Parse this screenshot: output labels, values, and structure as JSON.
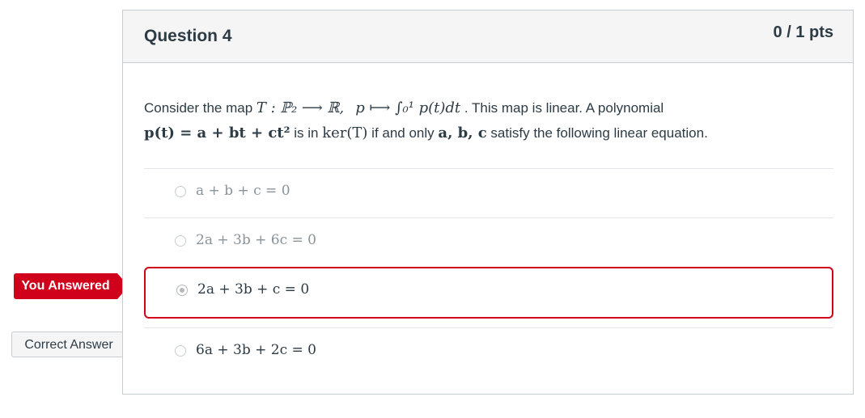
{
  "question": {
    "title": "Question 4",
    "points": "0 / 1 pts",
    "text_1": "Consider the map",
    "map_def": "T : ℙ₂ ⟶ ℝ,",
    "map_rule": "p ⟼ ∫₀¹ p(t)dt",
    "text_2": ". This map is linear. A polynomial",
    "poly": "p(t) = a + bt + ct²",
    "text_3": "is in",
    "kernel": "ker(T)",
    "text_4": "if and only",
    "vars": "a, b, c",
    "text_5": "satisfy the following linear equation."
  },
  "answers": [
    {
      "label": "a + b + c = 0",
      "selected": false
    },
    {
      "label": "2a + 3b + 6c = 0",
      "selected": false
    },
    {
      "label": "2a + 3b + c = 0",
      "selected": true
    },
    {
      "label": "6a + 3b + 2c = 0",
      "selected": false
    }
  ],
  "flags": {
    "you_answered": "You Answered",
    "correct_answer": "Correct Answer"
  },
  "colors": {
    "wrong": "#d0021b",
    "border": "#c7cdd1",
    "header_bg": "#f5f5f5"
  }
}
